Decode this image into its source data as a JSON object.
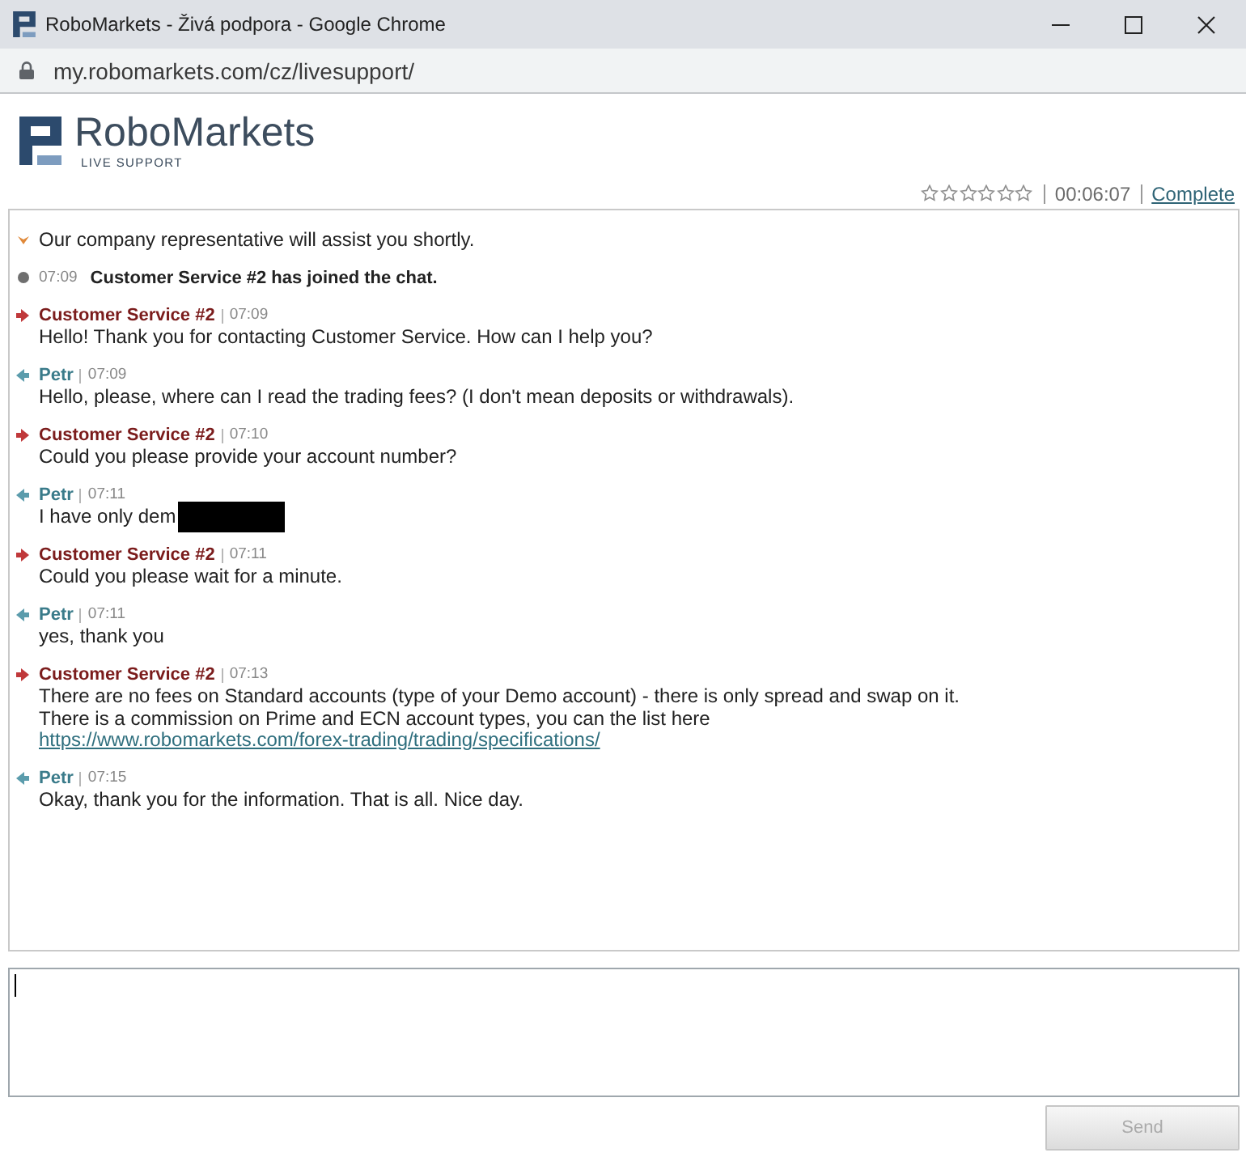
{
  "window": {
    "title": "RoboMarkets - Živá podpora - Google Chrome"
  },
  "address_bar": {
    "url": "my.robomarkets.com/cz/livesupport/"
  },
  "header": {
    "logo_text": "RoboMarkets",
    "logo_subtitle": "LIVE SUPPORT"
  },
  "status": {
    "stars": 0,
    "duration": "00:06:07",
    "complete_link": "Complete"
  },
  "messages": [
    {
      "kind": "notice",
      "text": "Our company representative will assist you shortly.",
      "redacted": false
    },
    {
      "kind": "event",
      "time": "07:09",
      "text": "Customer Service #2 has joined the chat.",
      "redacted": false
    },
    {
      "kind": "agent",
      "author": "Customer Service #2",
      "time": "07:09",
      "lines": [
        "Hello! Thank you for contacting Customer Service. How can I help you?"
      ],
      "redacted": false
    },
    {
      "kind": "visitor",
      "author": "Petr",
      "time": "07:09",
      "lines": [
        "Hello, please, where can I read the trading fees? (I don't mean deposits or withdrawals)."
      ],
      "redacted": false
    },
    {
      "kind": "agent",
      "author": "Customer Service #2",
      "time": "07:10",
      "lines": [
        "Could you please provide your account number?"
      ],
      "redacted": false
    },
    {
      "kind": "visitor",
      "author": "Petr",
      "time": "07:11",
      "lines": [
        "I have only dem"
      ],
      "redacted": true
    },
    {
      "kind": "agent",
      "author": "Customer Service #2",
      "time": "07:11",
      "lines": [
        "Could you please wait for a minute."
      ],
      "redacted": false
    },
    {
      "kind": "visitor",
      "author": "Petr",
      "time": "07:11",
      "lines": [
        "yes, thank you"
      ],
      "redacted": false
    },
    {
      "kind": "agent",
      "author": "Customer Service #2",
      "time": "07:13",
      "lines": [
        "There are no fees on Standard accounts (type of your Demo account) - there is only spread and swap on it.",
        "There is a commission on Prime and ECN account types, you can the list here"
      ],
      "link": "https://www.robomarkets.com/forex-trading/trading/specifications/",
      "redacted": false
    },
    {
      "kind": "visitor",
      "author": "Petr",
      "time": "07:15",
      "lines": [
        "Okay, thank you for the information. That is all. Nice day."
      ],
      "redacted": false
    }
  ],
  "composer": {
    "send_button": {
      "label": "Send",
      "disabled": true
    }
  }
}
